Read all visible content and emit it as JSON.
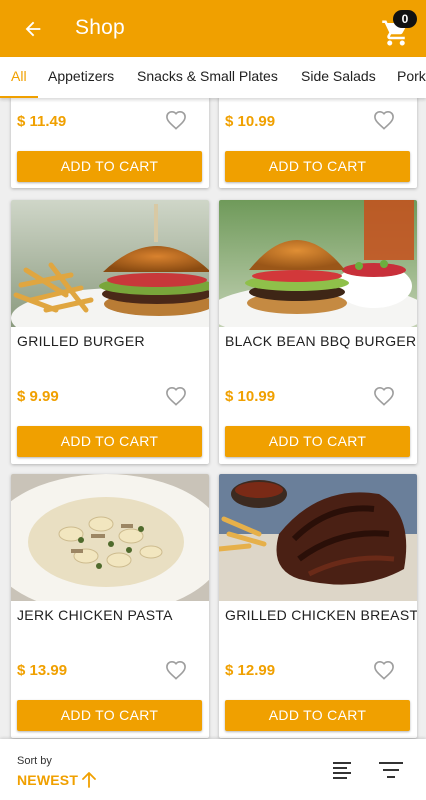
{
  "appbar": {
    "title": "Shop",
    "back_icon": "arrow-left-icon",
    "cart_icon": "shopping-cart-icon",
    "cart_count": "0",
    "color": "#f0a000"
  },
  "tabs": [
    {
      "label": "All",
      "active": true
    },
    {
      "label": "Appetizers",
      "active": false
    },
    {
      "label": "Snacks & Small Plates",
      "active": false
    },
    {
      "label": "Side Salads",
      "active": false
    },
    {
      "label": "Pork",
      "active": false
    }
  ],
  "products": [
    {
      "name": "",
      "price": "$ 11.49",
      "button": "ADD TO CART",
      "image": "none"
    },
    {
      "name": "",
      "price": "$ 10.99",
      "button": "ADD TO CART",
      "image": "none"
    },
    {
      "name": "GRILLED BURGER",
      "price": "$ 9.99",
      "button": "ADD TO CART",
      "image": "burger-with-fries-photo"
    },
    {
      "name": "BLACK BEAN BBQ BURGER",
      "price": "$ 10.99",
      "button": "ADD TO CART",
      "image": "burger-with-salad-photo"
    },
    {
      "name": "JERK CHICKEN PASTA",
      "price": "$ 13.99",
      "button": "ADD TO CART",
      "image": "chicken-pasta-photo"
    },
    {
      "name": "GRILLED CHICKEN BREAST",
      "price": "$ 12.99",
      "button": "ADD TO CART",
      "image": "ribs-with-fries-photo"
    }
  ],
  "sort": {
    "caption": "Sort by",
    "value": "NEWEST",
    "direction_icon": "arrow-up-icon"
  },
  "bottom_icons": {
    "list": "list-view-icon",
    "filter": "filter-icon"
  }
}
